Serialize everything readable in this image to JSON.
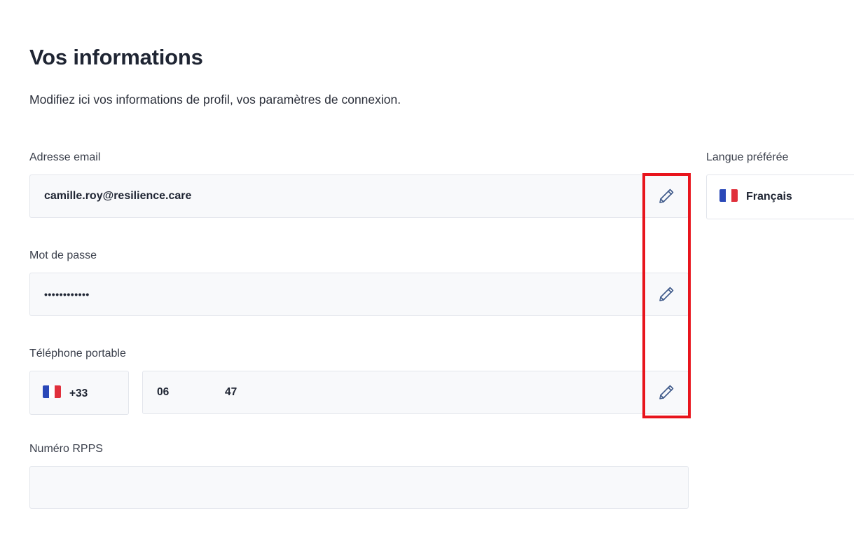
{
  "page": {
    "title": "Vos informations",
    "subtitle": "Modifiez ici vos informations de profil, vos paramètres de connexion."
  },
  "email": {
    "label": "Adresse email",
    "value": "camille.roy@resilience.care"
  },
  "password": {
    "label": "Mot de passe",
    "value": "••••••••••••"
  },
  "phone": {
    "label": "Téléphone portable",
    "country_code": "+33",
    "part1": "06",
    "part2": "47"
  },
  "rpps": {
    "label": "Numéro RPPS",
    "value": ""
  },
  "language": {
    "label": "Langue préférée",
    "value": "Français"
  },
  "icons": {
    "edit": "pencil-icon",
    "flag": "france-flag-icon"
  },
  "colors": {
    "highlight": "#e8141c",
    "icon": "#3f5a8a",
    "field_bg": "#f8f9fb"
  }
}
